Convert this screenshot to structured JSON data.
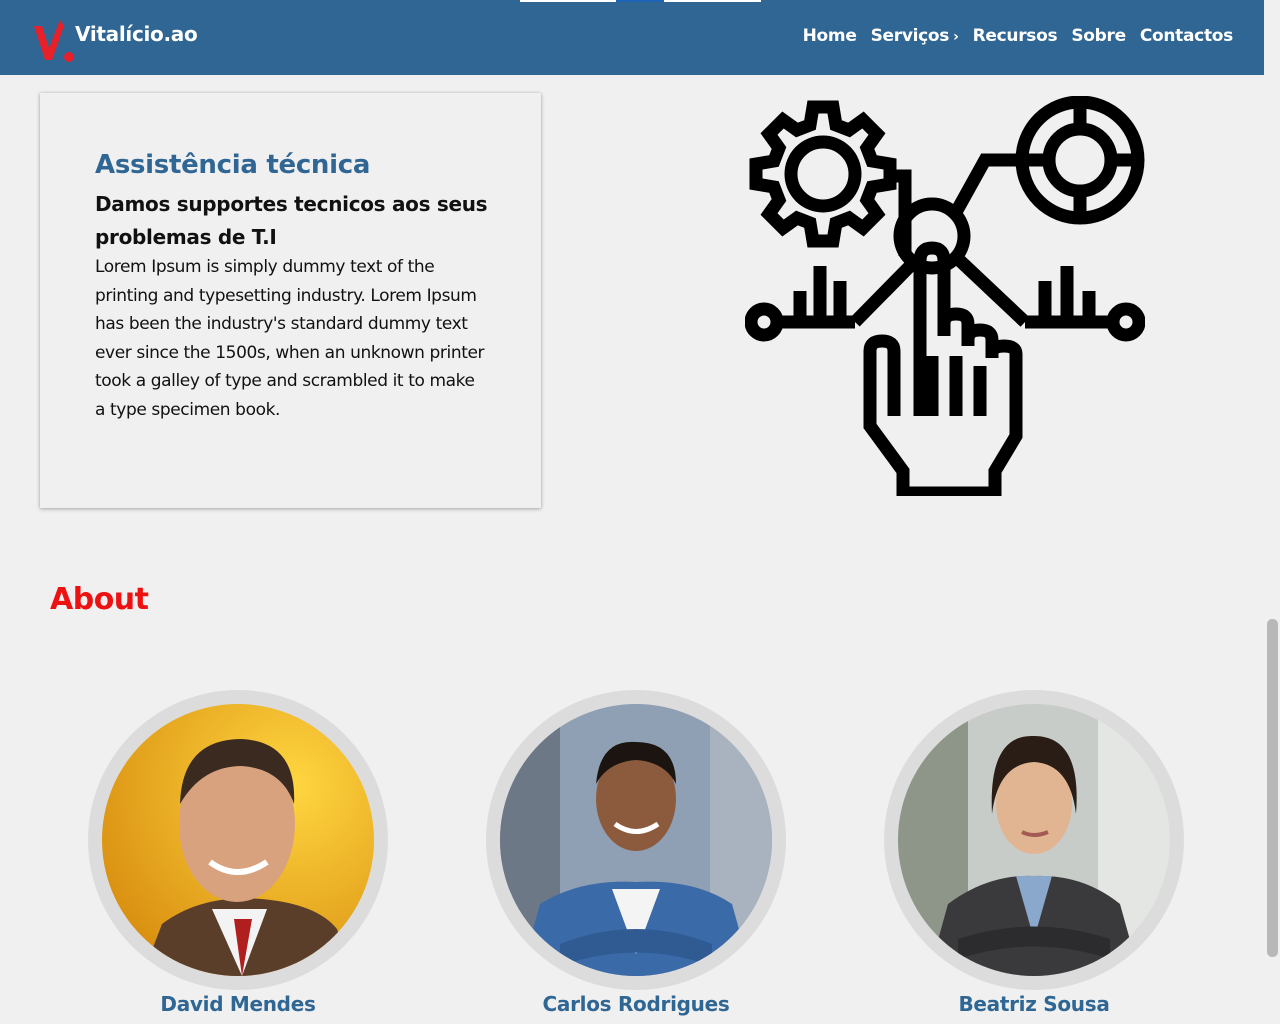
{
  "header": {
    "logo_text": "Vitalício.ao",
    "nav": [
      {
        "label": "Home"
      },
      {
        "label": "Serviços",
        "chevron": "›"
      },
      {
        "label": "Recursos"
      },
      {
        "label": "Sobre"
      },
      {
        "label": "Contactos"
      }
    ]
  },
  "service": {
    "title": "Assistência técnica",
    "subtitle": "Damos supportes tecnicos aos seus problemas de T.I",
    "body": "Lorem Ipsum is simply dummy text of the printing and typesetting industry. Lorem Ipsum has been the industry's standard dummy text ever since the 1500s, when an unknown printer took a galley of type and scrambled it to make a type specimen book.",
    "illustration_icon": "tech-support-touch-icon"
  },
  "about": {
    "title": "About",
    "members": [
      {
        "name": "David Mendes"
      },
      {
        "name": "Carlos Rodrigues"
      },
      {
        "name": "Beatriz Sousa"
      }
    ]
  },
  "colors": {
    "header_bg": "#2f6694",
    "accent_blue": "#2f6694",
    "about_red": "#ee1111",
    "page_bg": "#f0f0f0"
  }
}
